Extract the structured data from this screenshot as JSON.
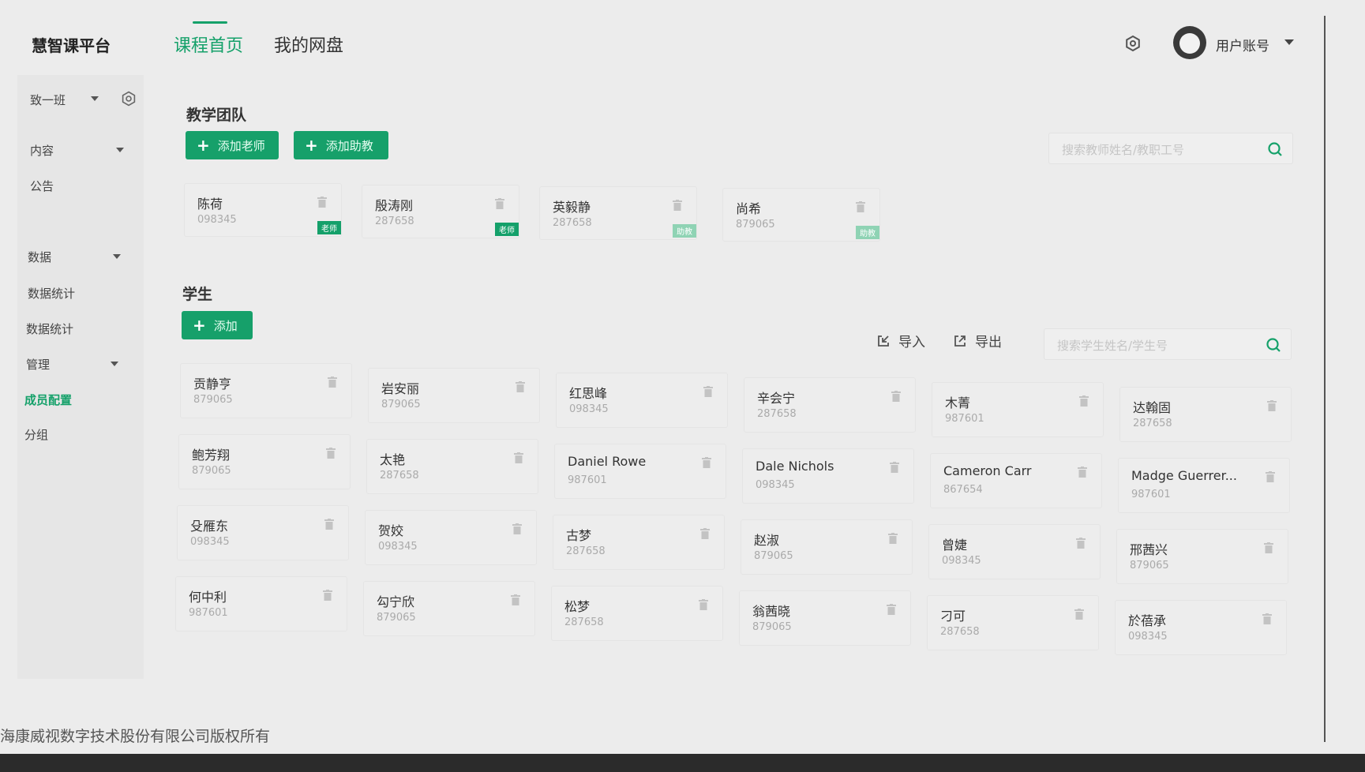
{
  "header": {
    "logo": "慧智课平台",
    "nav": [
      "课程首页",
      "我的网盘"
    ],
    "user": "用户账号"
  },
  "sidebar": {
    "class_select": "致一班",
    "items": [
      {
        "label": "内容",
        "caret": true
      },
      {
        "label": "公告",
        "caret": false
      },
      {
        "label": "数据",
        "caret": true
      },
      {
        "label": "数据统计",
        "caret": false
      },
      {
        "label": "数据统计",
        "caret": false
      },
      {
        "label": "管理",
        "caret": true
      },
      {
        "label": "成员配置",
        "caret": false,
        "active": true
      },
      {
        "label": "分组",
        "caret": false
      }
    ]
  },
  "team": {
    "title": "教学团队",
    "add_teacher": "添加老师",
    "add_ta": "添加助教",
    "search_placeholder": "搜索教师姓名/教职工号",
    "members": [
      {
        "name": "陈荷",
        "id": "098345",
        "role": "老师"
      },
      {
        "name": "殷涛刚",
        "id": "287658",
        "role": "老师"
      },
      {
        "name": "英毅静",
        "id": "287658",
        "role": "助教"
      },
      {
        "name": "尚希",
        "id": "879065",
        "role": "助教"
      }
    ]
  },
  "students": {
    "title": "学生",
    "add": "添加",
    "import": "导入",
    "export": "导出",
    "search_placeholder": "搜索学生姓名/学生号",
    "list": [
      {
        "name": "贡静亨",
        "id": "879065"
      },
      {
        "name": "岩安丽",
        "id": "879065"
      },
      {
        "name": "红思峰",
        "id": "098345"
      },
      {
        "name": "辛会宁",
        "id": "287658"
      },
      {
        "name": "木菁",
        "id": "987601"
      },
      {
        "name": "达翰固",
        "id": "287658"
      },
      {
        "name": "鲍芳翔",
        "id": "879065"
      },
      {
        "name": "太艳",
        "id": "287658"
      },
      {
        "name": "Daniel Rowe",
        "id": "987601"
      },
      {
        "name": "Dale Nichols",
        "id": "098345"
      },
      {
        "name": "Cameron Carr",
        "id": "867654"
      },
      {
        "name": "Madge Guerrer...",
        "id": "987601"
      },
      {
        "name": "殳雁东",
        "id": "098345"
      },
      {
        "name": "贺姣",
        "id": "098345"
      },
      {
        "name": "古梦",
        "id": "287658"
      },
      {
        "name": "赵淑",
        "id": "879065"
      },
      {
        "name": "曾婕",
        "id": "098345"
      },
      {
        "name": "邢茜兴",
        "id": "879065"
      },
      {
        "name": "何中利",
        "id": "987601"
      },
      {
        "name": "勾宁欣",
        "id": "879065"
      },
      {
        "name": "松梦",
        "id": "287658"
      },
      {
        "name": "翁茜晓",
        "id": "879065"
      },
      {
        "name": "刁可",
        "id": "287658"
      },
      {
        "name": "於蓓承",
        "id": "098345"
      }
    ]
  },
  "footer": "海康威视数字技术股份有限公司版权所有",
  "colors": {
    "accent": "#15a16a",
    "background": "#ececec"
  }
}
